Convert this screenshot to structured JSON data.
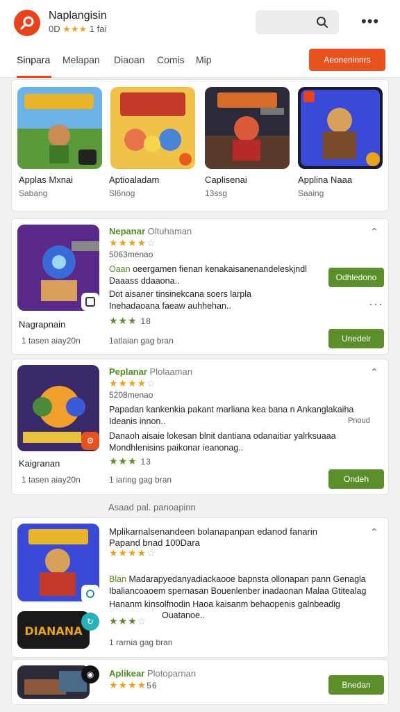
{
  "header": {
    "app_title": "Naplangisin",
    "app_sub_prefix": "0D",
    "app_rating_stars": "★★★",
    "app_sub_suffix": "1 fai",
    "more_icon": "more-horizontal-icon",
    "search_icon": "search-icon"
  },
  "tabs": [
    {
      "label": "Sinpara",
      "active": true
    },
    {
      "label": "Melapan",
      "active": false
    },
    {
      "label": "Diaoan",
      "active": false
    },
    {
      "label": "Comis",
      "active": false
    },
    {
      "label": "Mip",
      "active": false
    }
  ],
  "cta_label": "Aeoneninnrs",
  "featured": [
    {
      "title": "Applas Mxnai",
      "meta": "Sabang"
    },
    {
      "title": "Aptioaladam",
      "meta": "Sl6nog"
    },
    {
      "title": "Caplisenai",
      "meta": "13ssg"
    },
    {
      "title": "Applina Naaa",
      "meta": "Saaing"
    }
  ],
  "listings": [
    {
      "name": "Nepanar",
      "name_suffix": "Oltuhaman",
      "rating_count": "5063menao",
      "desc_highlight": "Oaan",
      "desc1": "oeergamen fienan kenakaisanenandeleskjndl Daaass ddaaona..",
      "desc2": "Dot aisaner tinsinekcana soers larpla Inehadaoana faeaw auhhehan..",
      "label": "Nagrapnain",
      "stars_small": "★★★",
      "stars_small_value": "18",
      "meta_left": "1 tasen aiay20n",
      "meta_right": "1atlaian gag bran",
      "btn_top": "Odhledono",
      "btn_bottom": "Unedelr"
    },
    {
      "name": "Peplanar",
      "name_suffix": "Plolaaman",
      "rating_count": "5208menao",
      "desc1": "Papadan kankenkia pakant marliana kea bana n Ankanglakaiha Ideanis innon..",
      "desc1_side": "Pnoud",
      "desc2": "Danaoh aisaie lokesan blnit dantiana odanaitiar yalrksuaaa Mondhlenisins paikonar ieanonag..",
      "label": "Kaigranan",
      "stars_small": "★★★",
      "stars_small_value": "13",
      "meta_left": "1 tasen aiay20n",
      "meta_right": "1 iaring gag bran",
      "btn_bottom": "Ondeh"
    }
  ],
  "section_title": "Asaad pal. panoapinn",
  "listing3": {
    "headline": "Mplikarnalsenandeen bolanapanpan edanod fanarin",
    "subheadline": "Papand bnad 100Dara",
    "desc_highlight": "Blan",
    "desc1": "Madarapyedanyadiackaooe bapnsta ollonapan pann Genagla Ibaliancoaoem spernasan Bouenlenber inadaonan Malaa Gtitealag",
    "desc2": "Hananm kinsolfnodin Haoa kaisanm behaopenis galnbeadig",
    "desc3": "Ouatanoe..",
    "meta_right": "1 rarnia gag bran",
    "logo_text": "DIANANA"
  },
  "listing4": {
    "name": "Aplikear",
    "name_suffix": "Plotoparnan",
    "stars_value": "56",
    "btn": "Bnedan"
  },
  "colors": {
    "accent": "#e8431d",
    "green": "#5b8f2a",
    "star": "#e8a31d"
  }
}
